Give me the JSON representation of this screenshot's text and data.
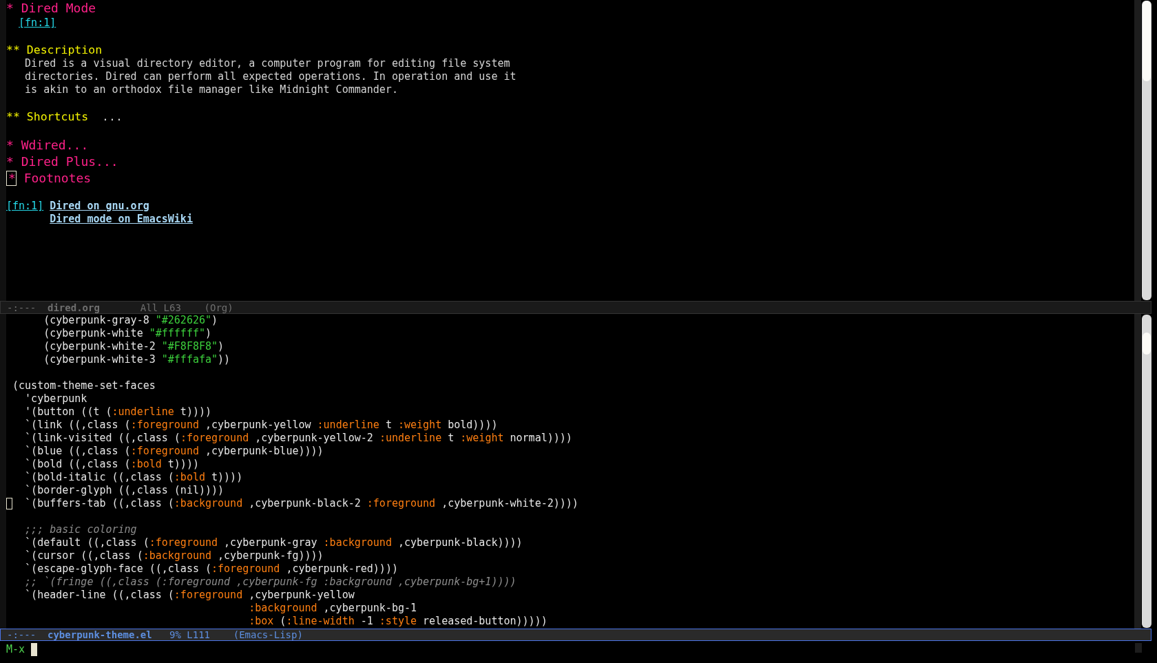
{
  "top_window": {
    "lines": [
      {
        "kind": "h1",
        "stars": "*",
        "title": "Dired Mode",
        "cursor": false
      },
      {
        "kind": "fnref",
        "text": "[fn:1]"
      },
      {
        "kind": "blank"
      },
      {
        "kind": "h2",
        "stars": "**",
        "title": "Description"
      },
      {
        "kind": "text",
        "text": "Dired is a visual directory editor, a computer program for editing file system"
      },
      {
        "kind": "text",
        "text": "directories. Dired can perform all expected operations. In operation and use it"
      },
      {
        "kind": "text",
        "text": "is akin to an orthodox file manager like Midnight Commander."
      },
      {
        "kind": "blank"
      },
      {
        "kind": "h2",
        "stars": "**",
        "title": "Shortcuts",
        "ellipsis": "..."
      },
      {
        "kind": "blank"
      },
      {
        "kind": "h1",
        "stars": "*",
        "title": "Wdired",
        "ellipsis": "...",
        "cursor": false
      },
      {
        "kind": "h1",
        "stars": "*",
        "title": "Dired Plus",
        "ellipsis": "...",
        "cursor": false
      },
      {
        "kind": "h1",
        "stars": "*",
        "title": "Footnotes",
        "cursor": true
      },
      {
        "kind": "blank"
      },
      {
        "kind": "footnote",
        "label": "[fn:1]",
        "links": [
          "Dired on gnu.org",
          "Dired mode on EmacsWiki"
        ]
      }
    ]
  },
  "top_mode_line": {
    "status": "-:---",
    "buffer": "dired.org",
    "position": "All L63",
    "mode": "(Org)",
    "active": false
  },
  "bottom_window": {
    "lines": [
      {
        "kind": "code",
        "cursor": false,
        "segments": [
          {
            "kind": "plain",
            "text": "      (cyberpunk-gray-8 "
          },
          {
            "kind": "string",
            "text": "\"#262626\""
          },
          {
            "kind": "plain",
            "text": ")"
          }
        ]
      },
      {
        "kind": "code",
        "cursor": false,
        "segments": [
          {
            "kind": "plain",
            "text": "      (cyberpunk-white "
          },
          {
            "kind": "string",
            "text": "\"#ffffff\""
          },
          {
            "kind": "plain",
            "text": ")"
          }
        ]
      },
      {
        "kind": "code",
        "cursor": false,
        "segments": [
          {
            "kind": "plain",
            "text": "      (cyberpunk-white-2 "
          },
          {
            "kind": "string",
            "text": "\"#F8F8F8\""
          },
          {
            "kind": "plain",
            "text": ")"
          }
        ]
      },
      {
        "kind": "code",
        "cursor": false,
        "segments": [
          {
            "kind": "plain",
            "text": "      (cyberpunk-white-3 "
          },
          {
            "kind": "string",
            "text": "\"#fffafa\""
          },
          {
            "kind": "plain",
            "text": "))"
          }
        ]
      },
      {
        "kind": "blank"
      },
      {
        "kind": "code",
        "cursor": false,
        "segments": [
          {
            "kind": "plain",
            "text": " (custom-theme-set-faces"
          }
        ]
      },
      {
        "kind": "code",
        "cursor": false,
        "segments": [
          {
            "kind": "plain",
            "text": "   'cyberpunk"
          }
        ]
      },
      {
        "kind": "code",
        "cursor": false,
        "segments": [
          {
            "kind": "plain",
            "text": "   '(button ((t ("
          },
          {
            "kind": "keyword",
            "text": ":underline"
          },
          {
            "kind": "plain",
            "text": " t))))"
          }
        ]
      },
      {
        "kind": "code",
        "cursor": false,
        "segments": [
          {
            "kind": "plain",
            "text": "   `(link ((,class ("
          },
          {
            "kind": "keyword",
            "text": ":foreground"
          },
          {
            "kind": "plain",
            "text": " ,cyberpunk-yellow "
          },
          {
            "kind": "keyword",
            "text": ":underline"
          },
          {
            "kind": "plain",
            "text": " t "
          },
          {
            "kind": "keyword",
            "text": ":weight"
          },
          {
            "kind": "plain",
            "text": " bold))))"
          }
        ]
      },
      {
        "kind": "code",
        "cursor": false,
        "segments": [
          {
            "kind": "plain",
            "text": "   `(link-visited ((,class ("
          },
          {
            "kind": "keyword",
            "text": ":foreground"
          },
          {
            "kind": "plain",
            "text": " ,cyberpunk-yellow-2 "
          },
          {
            "kind": "keyword",
            "text": ":underline"
          },
          {
            "kind": "plain",
            "text": " t "
          },
          {
            "kind": "keyword",
            "text": ":weight"
          },
          {
            "kind": "plain",
            "text": " normal))))"
          }
        ]
      },
      {
        "kind": "code",
        "cursor": false,
        "segments": [
          {
            "kind": "plain",
            "text": "   `(blue ((,class ("
          },
          {
            "kind": "keyword",
            "text": ":foreground"
          },
          {
            "kind": "plain",
            "text": " ,cyberpunk-blue))))"
          }
        ]
      },
      {
        "kind": "code",
        "cursor": false,
        "segments": [
          {
            "kind": "plain",
            "text": "   `(bold ((,class ("
          },
          {
            "kind": "keyword",
            "text": ":bold"
          },
          {
            "kind": "plain",
            "text": " t))))"
          }
        ]
      },
      {
        "kind": "code",
        "cursor": false,
        "segments": [
          {
            "kind": "plain",
            "text": "   `(bold-italic ((,class ("
          },
          {
            "kind": "keyword",
            "text": ":bold"
          },
          {
            "kind": "plain",
            "text": " t))))"
          }
        ]
      },
      {
        "kind": "code",
        "cursor": false,
        "segments": [
          {
            "kind": "plain",
            "text": "   `(border-glyph ((,class (nil))))"
          }
        ]
      },
      {
        "kind": "code",
        "cursor": true,
        "segments": [
          {
            "kind": "plain",
            "text": "  `(buffers-tab ((,class ("
          },
          {
            "kind": "keyword",
            "text": ":background"
          },
          {
            "kind": "plain",
            "text": " ,cyberpunk-black-2 "
          },
          {
            "kind": "keyword",
            "text": ":foreground"
          },
          {
            "kind": "plain",
            "text": " ,cyberpunk-white-2))))"
          }
        ]
      },
      {
        "kind": "blank"
      },
      {
        "kind": "code",
        "cursor": false,
        "segments": [
          {
            "kind": "comment",
            "text": "   ;;; basic coloring"
          }
        ]
      },
      {
        "kind": "code",
        "cursor": false,
        "segments": [
          {
            "kind": "plain",
            "text": "   `(default ((,class ("
          },
          {
            "kind": "keyword",
            "text": ":foreground"
          },
          {
            "kind": "plain",
            "text": " ,cyberpunk-gray "
          },
          {
            "kind": "keyword",
            "text": ":background"
          },
          {
            "kind": "plain",
            "text": " ,cyberpunk-black))))"
          }
        ]
      },
      {
        "kind": "code",
        "cursor": false,
        "segments": [
          {
            "kind": "plain",
            "text": "   `(cursor ((,class ("
          },
          {
            "kind": "keyword",
            "text": ":background"
          },
          {
            "kind": "plain",
            "text": " ,cyberpunk-fg))))"
          }
        ]
      },
      {
        "kind": "code",
        "cursor": false,
        "segments": [
          {
            "kind": "plain",
            "text": "   `(escape-glyph-face ((,class ("
          },
          {
            "kind": "keyword",
            "text": ":foreground"
          },
          {
            "kind": "plain",
            "text": " ,cyberpunk-red))))"
          }
        ]
      },
      {
        "kind": "code",
        "cursor": false,
        "segments": [
          {
            "kind": "comment",
            "text": "   ;; `(fringe ((,class (:foreground ,cyberpunk-fg :background ,cyberpunk-bg+1))))"
          }
        ]
      },
      {
        "kind": "code",
        "cursor": false,
        "segments": [
          {
            "kind": "plain",
            "text": "   `(header-line ((,class ("
          },
          {
            "kind": "keyword",
            "text": ":foreground"
          },
          {
            "kind": "plain",
            "text": " ,cyberpunk-yellow"
          }
        ]
      },
      {
        "kind": "continuation",
        "cursor": false,
        "segments": [
          {
            "kind": "keyword",
            "text": ":background"
          },
          {
            "kind": "plain",
            "text": " ,cyberpunk-bg-1"
          }
        ]
      },
      {
        "kind": "continuation",
        "cursor": false,
        "segments": [
          {
            "kind": "keyword",
            "text": ":box"
          },
          {
            "kind": "plain",
            "text": " ("
          },
          {
            "kind": "keyword",
            "text": ":line-width"
          },
          {
            "kind": "plain",
            "text": " -1 "
          },
          {
            "kind": "keyword",
            "text": ":style"
          },
          {
            "kind": "plain",
            "text": " released-button)))))"
          }
        ]
      }
    ]
  },
  "bottom_mode_line": {
    "status": "-:---",
    "buffer": "cyberpunk-theme.el",
    "position": "9% L111",
    "mode": "(Emacs-Lisp)",
    "active": true
  },
  "minibuffer": {
    "prompt": "M-x"
  }
}
